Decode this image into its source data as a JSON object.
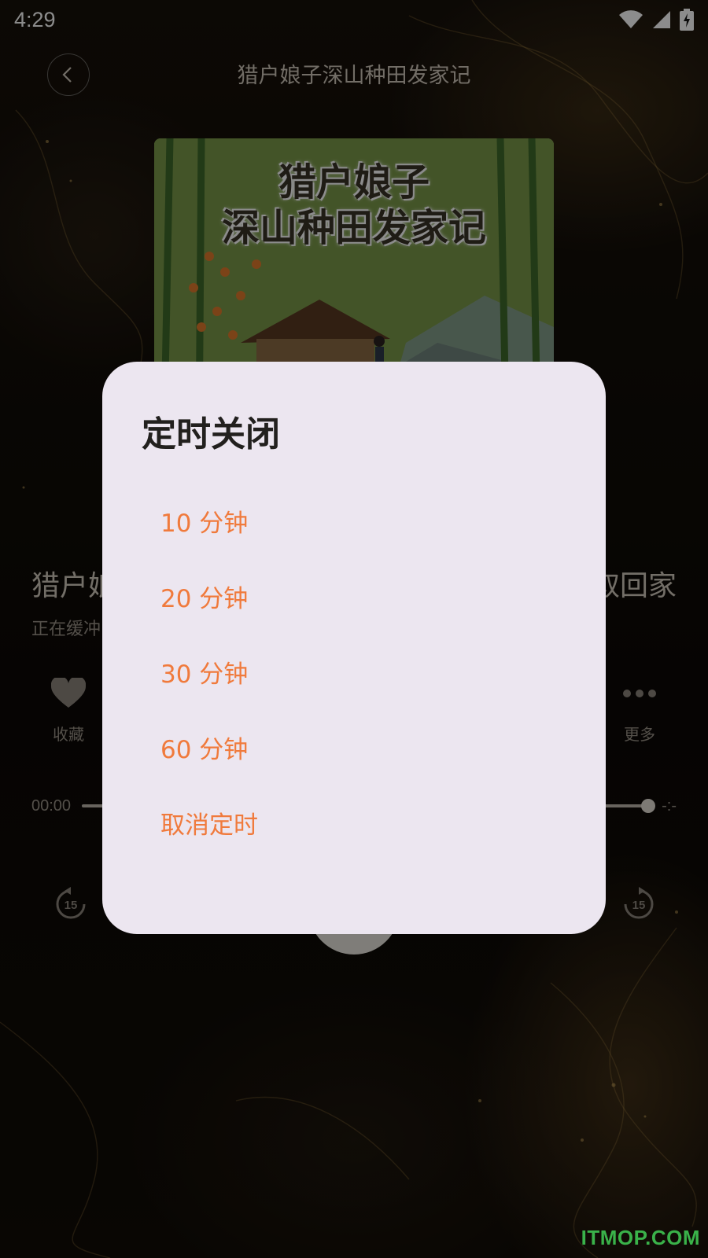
{
  "status_bar": {
    "time": "4:29",
    "icons": [
      "wifi-icon",
      "signal-icon",
      "battery-charging-icon"
    ]
  },
  "header": {
    "title": "猎户娘子深山种田发家记",
    "back_icon": "chevron-left-icon"
  },
  "cover": {
    "title_line1": "猎户娘子",
    "title_line2": "深山种田发家记"
  },
  "track": {
    "title_left": "猎户娘",
    "title_right": "取回家",
    "status_left": "正在缓冲"
  },
  "actions": {
    "favorite_label": "收藏",
    "more_label": "更多"
  },
  "progress": {
    "current": "00:00",
    "total": "-:-",
    "fraction": 1.0
  },
  "controls": {
    "rewind_value": "15",
    "forward_value": "15"
  },
  "dialog": {
    "title": "定时关闭",
    "options": [
      "10 分钟",
      "20 分钟",
      "30 分钟",
      "60 分钟",
      "取消定时"
    ]
  },
  "watermark": "ITMOP.COM",
  "colors": {
    "accent": "#f07a3c",
    "dialog_bg": "#ece6f0",
    "watermark": "#3ab24a"
  }
}
